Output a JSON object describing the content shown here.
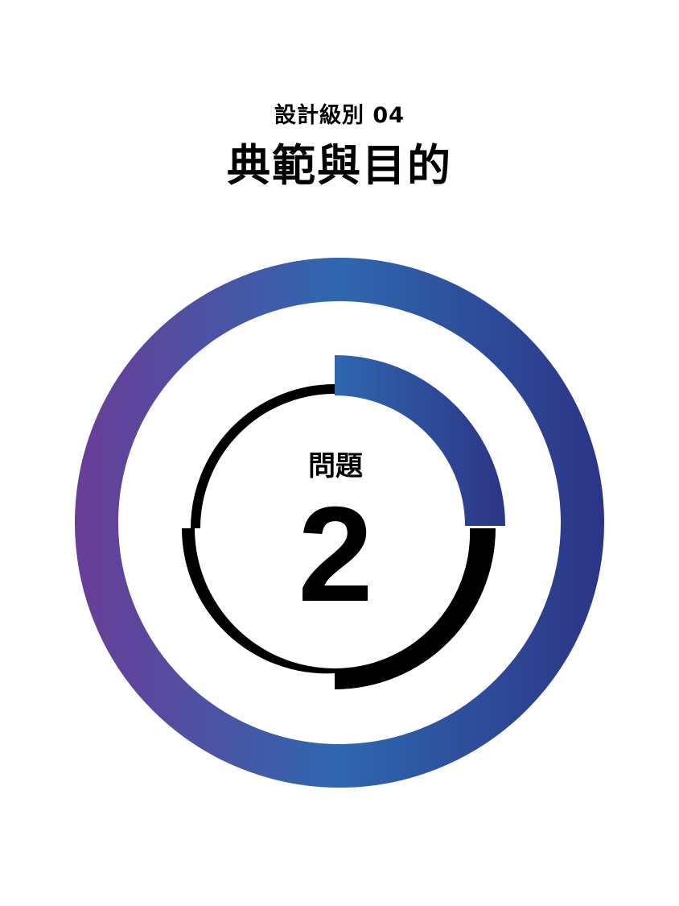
{
  "header": {
    "subtitle": "設計級別 04",
    "title": "典範與目的"
  },
  "badge": {
    "label": "問題",
    "number": "2",
    "colors": {
      "ring_gradient_start": "#6a3d97",
      "ring_gradient_mid": "#2f67b0",
      "ring_gradient_end": "#2c3585",
      "progress_dark": "#000000"
    }
  }
}
